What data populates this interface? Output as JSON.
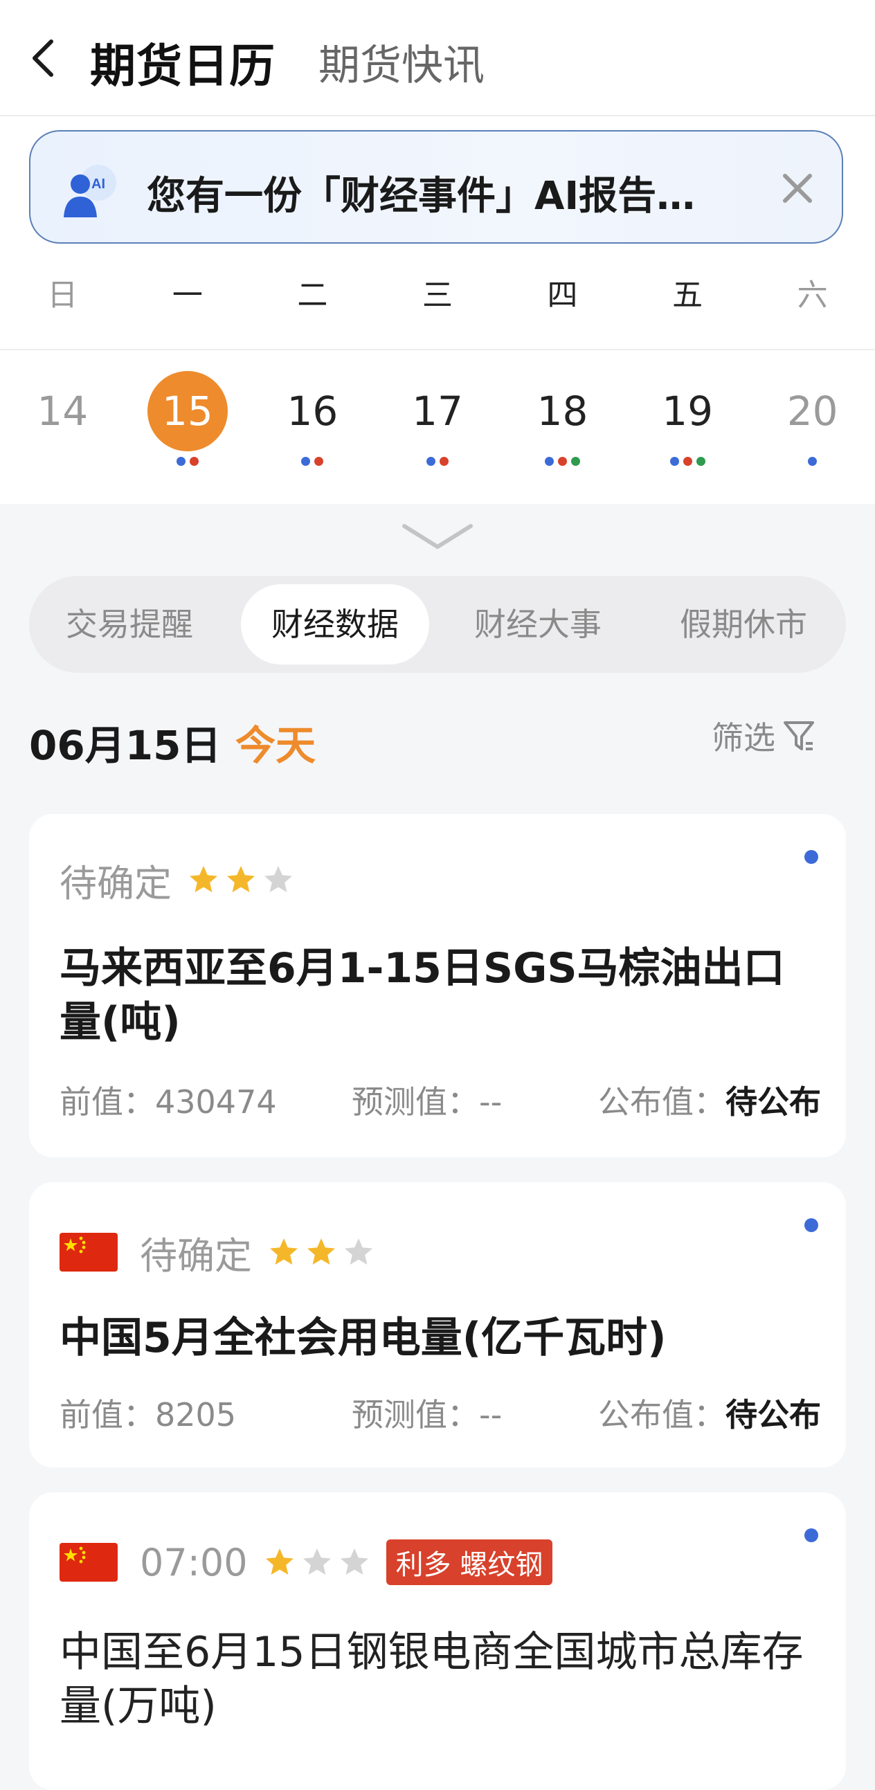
{
  "header": {
    "title": "期货日历",
    "tab": "期货快讯",
    "back_icon": "chevron-left-icon"
  },
  "banner": {
    "text": "您有一份「财经事件」AI报告…",
    "icon": "ai-avatar-icon",
    "close_icon": "close-icon",
    "badge": "AI"
  },
  "calendar": {
    "weekdays": [
      "日",
      "一",
      "二",
      "三",
      "四",
      "五",
      "六"
    ],
    "days": [
      {
        "num": "14",
        "dots": []
      },
      {
        "num": "15",
        "dots": [
          "#3c6bd8",
          "#d8412b"
        ],
        "selected": true
      },
      {
        "num": "16",
        "dots": [
          "#3c6bd8",
          "#d8412b"
        ]
      },
      {
        "num": "17",
        "dots": [
          "#3c6bd8",
          "#d8412b"
        ]
      },
      {
        "num": "18",
        "dots": [
          "#3c6bd8",
          "#d8412b",
          "#2e9b4f"
        ]
      },
      {
        "num": "19",
        "dots": [
          "#3c6bd8",
          "#d8412b",
          "#2e9b4f"
        ]
      },
      {
        "num": "20",
        "dots": [
          "#3c6bd8"
        ]
      }
    ],
    "selected_color": "#ee8b2c"
  },
  "tabs": [
    "交易提醒",
    "财经数据",
    "财经大事",
    "假期休市"
  ],
  "active_tab": "财经数据",
  "date_row": {
    "date": "06月15日",
    "today": "今天",
    "filter": "筛选"
  },
  "cards": [
    {
      "time": "待确定",
      "stars": 2,
      "flag": null,
      "title": "马来西亚至6月1-15日SGS马棕油出口量(吨)",
      "prev_label": "前值：",
      "prev": "430474",
      "forecast_label": "预测值：",
      "forecast": "--",
      "actual_label": "公布值：",
      "actual": "待公布"
    },
    {
      "time": "待确定",
      "stars": 2,
      "flag": "china-flag-icon",
      "title": "中国5月全社会用电量(亿千瓦时)",
      "prev_label": "前值：",
      "prev": "8205",
      "forecast_label": "预测值：",
      "forecast": "--",
      "actual_label": "公布值：",
      "actual": "待公布"
    },
    {
      "time": "07:00",
      "stars": 1,
      "flag": "china-flag-icon",
      "tag": "利多 螺纹钢",
      "title": "中国至6月15日钢银电商全国城市总库存量(万吨)"
    }
  ],
  "colors": {
    "accent": "#ee8b2c",
    "tag_red": "#d8412b",
    "dot_blue": "#3c6bd8",
    "star_gold": "#f5b72a"
  }
}
